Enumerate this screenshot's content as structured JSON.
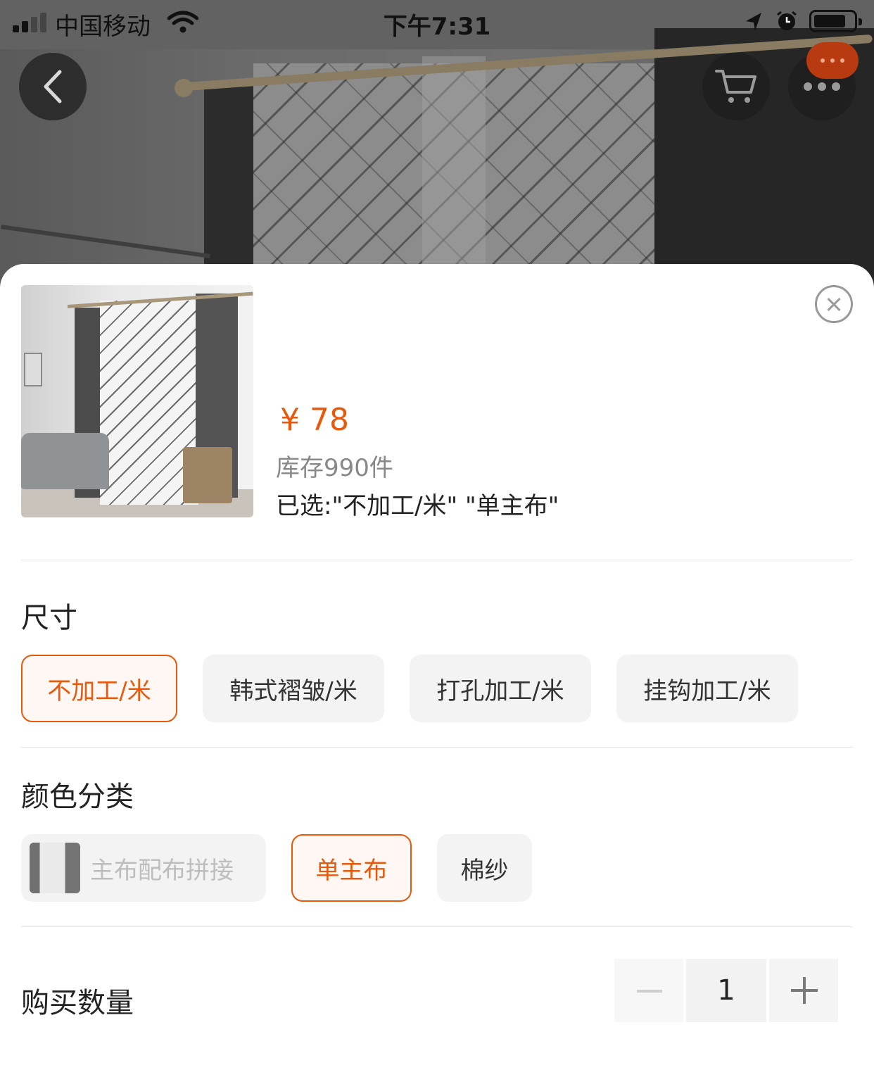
{
  "status_bar": {
    "carrier": "中国移动",
    "time": "下午7:31"
  },
  "product": {
    "price": "¥ 78",
    "stock": "库存990件",
    "selected": "已选:\"不加工/米\" \"单主布\""
  },
  "size": {
    "title": "尺寸",
    "options": [
      {
        "label": "不加工/米",
        "state": "selected"
      },
      {
        "label": "韩式褶皱/米",
        "state": "normal"
      },
      {
        "label": "打孔加工/米",
        "state": "normal"
      },
      {
        "label": "挂钩加工/米",
        "state": "normal"
      }
    ]
  },
  "color": {
    "title": "颜色分类",
    "options": [
      {
        "label": "主布配布拼接",
        "state": "disabled"
      },
      {
        "label": "单主布",
        "state": "selected"
      },
      {
        "label": "棉纱",
        "state": "normal"
      }
    ]
  },
  "quantity": {
    "label": "购买数量",
    "value": "1"
  },
  "colors": {
    "accent": "#e8590c",
    "badge": "#b83a10"
  }
}
